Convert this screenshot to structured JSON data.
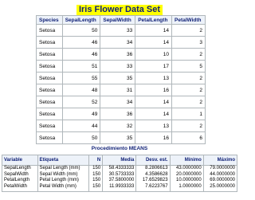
{
  "title": "Iris Flower Data Set",
  "iris": {
    "headers": [
      "Species",
      "SepalLength",
      "SepalWidth",
      "PetalLength",
      "PetalWidth"
    ],
    "rows": [
      [
        "Setosa",
        "50",
        "33",
        "14",
        "2"
      ],
      [
        "Setosa",
        "46",
        "34",
        "14",
        "3"
      ],
      [
        "Setosa",
        "46",
        "36",
        "10",
        "2"
      ],
      [
        "Setosa",
        "51",
        "33",
        "17",
        "5"
      ],
      [
        "Setosa",
        "55",
        "35",
        "13",
        "2"
      ],
      [
        "Setosa",
        "48",
        "31",
        "16",
        "2"
      ],
      [
        "Setosa",
        "52",
        "34",
        "14",
        "2"
      ],
      [
        "Setosa",
        "49",
        "36",
        "14",
        "1"
      ],
      [
        "Setosa",
        "44",
        "32",
        "13",
        "2"
      ],
      [
        "Setosa",
        "50",
        "35",
        "16",
        "6"
      ]
    ]
  },
  "means": {
    "title": "Procedimiento MEANS",
    "headers": [
      "Variable",
      "Etiqueta",
      "N",
      "Media",
      "Desv. est.",
      "Mínimo",
      "Máximo"
    ],
    "variable": "SepalLength\nSepalWidth\nPetalLength\nPetalWidth",
    "etiqueta": "Sepal Length (mm)\nSepal Width (mm)\nPetal Length (mm)\nPetal Width (mm)",
    "n": "150\n150\n150\n150",
    "media": "58.4333333\n30.5733333\n37.5800000\n11.9933333",
    "desv": "8.2806613\n4.3586628\n17.6529823\n7.6223767",
    "minimo": "43.0000000\n20.0000000\n10.0000000\n1.0000000",
    "maximo": "79.0000000\n44.0000000\n69.0000000\n25.0000000"
  }
}
